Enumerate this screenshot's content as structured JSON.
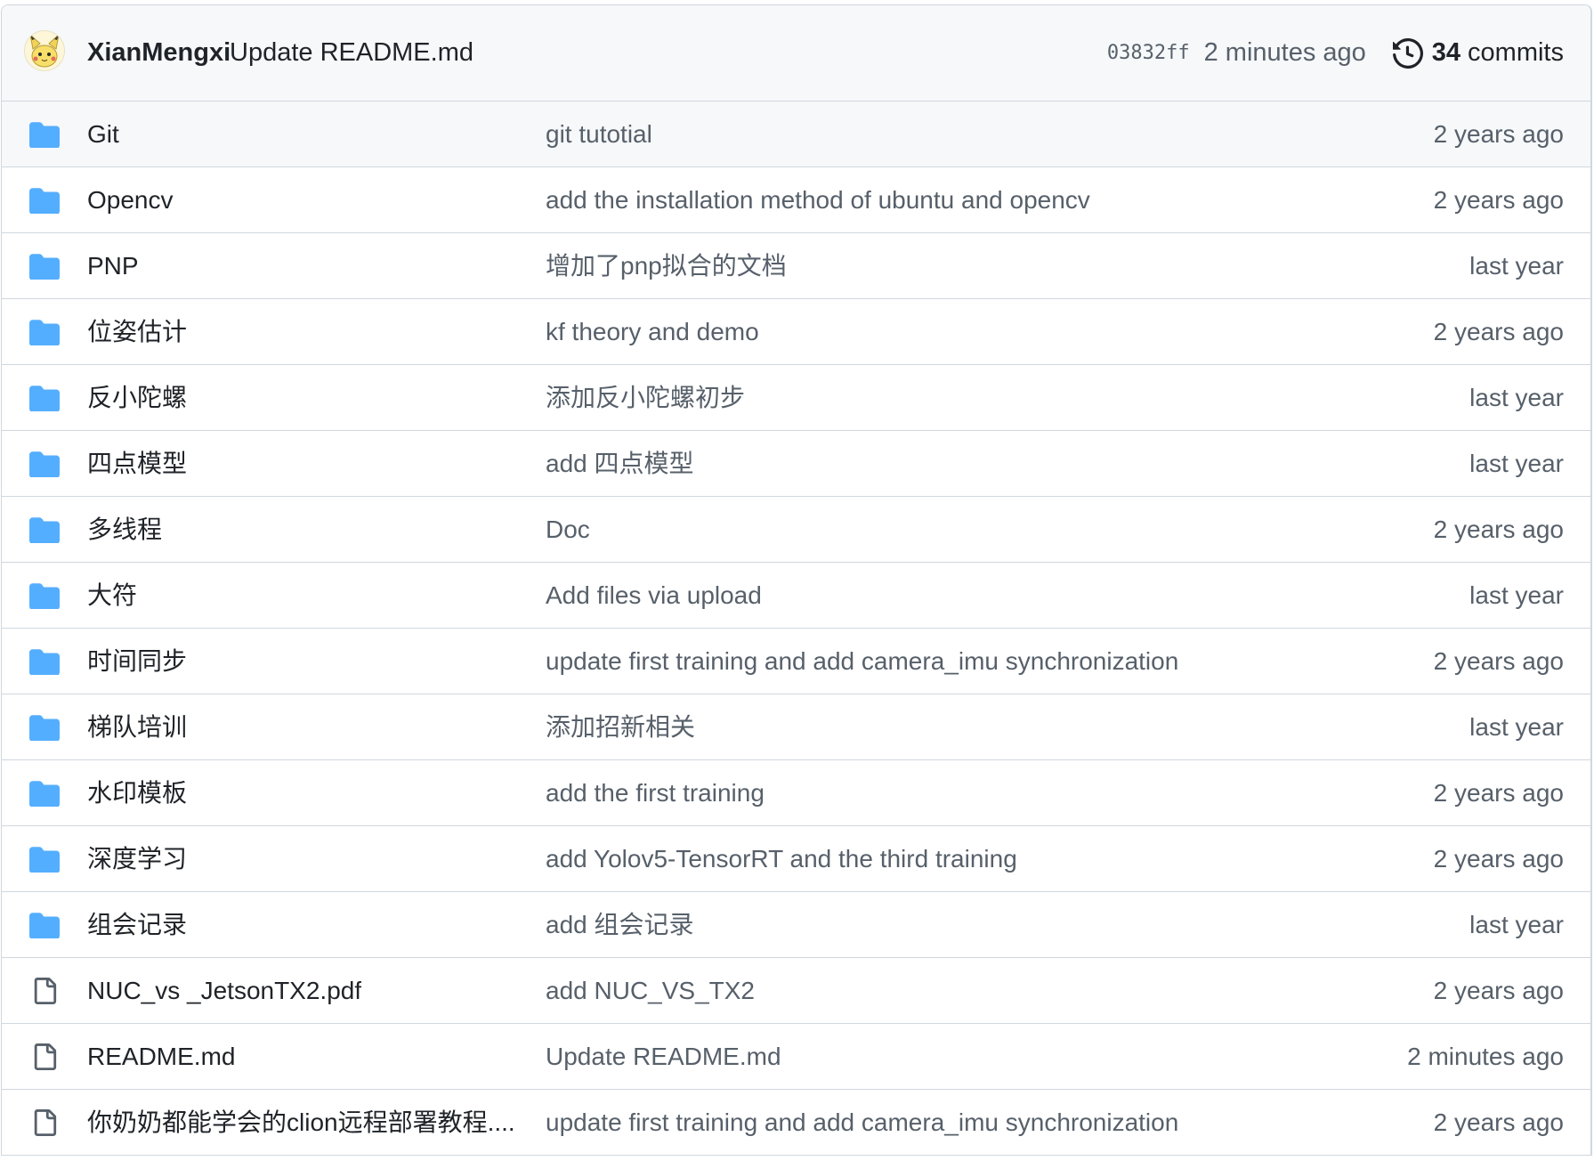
{
  "header": {
    "author": "XianMengxi",
    "message": "Update README.md",
    "sha": "03832ff",
    "age": "2 minutes ago",
    "commit_count": "34",
    "commit_label": "commits"
  },
  "colors": {
    "folder": "#54aeff",
    "file_icon": "#57606a",
    "muted_text": "#57606a",
    "border": "#d0d7de"
  },
  "files": [
    {
      "type": "folder",
      "icon": "folder-icon",
      "name": "Git",
      "message": "git tutotial",
      "age": "2 years ago"
    },
    {
      "type": "folder",
      "icon": "folder-icon",
      "name": "Opencv",
      "message": "add the installation method of ubuntu and opencv",
      "age": "2 years ago"
    },
    {
      "type": "folder",
      "icon": "folder-icon",
      "name": "PNP",
      "message": "增加了pnp拟合的文档",
      "age": "last year"
    },
    {
      "type": "folder",
      "icon": "folder-icon",
      "name": "位姿估计",
      "message": "kf theory and demo",
      "age": "2 years ago"
    },
    {
      "type": "folder",
      "icon": "folder-icon",
      "name": "反小陀螺",
      "message": "添加反小陀螺初步",
      "age": "last year"
    },
    {
      "type": "folder",
      "icon": "folder-icon",
      "name": "四点模型",
      "message": "add 四点模型",
      "age": "last year"
    },
    {
      "type": "folder",
      "icon": "folder-icon",
      "name": "多线程",
      "message": "Doc",
      "age": "2 years ago"
    },
    {
      "type": "folder",
      "icon": "folder-icon",
      "name": "大符",
      "message": "Add files via upload",
      "age": "last year"
    },
    {
      "type": "folder",
      "icon": "folder-icon",
      "name": "时间同步",
      "message": "update first training and add camera_imu synchronization",
      "age": "2 years ago"
    },
    {
      "type": "folder",
      "icon": "folder-icon",
      "name": "梯队培训",
      "message": "添加招新相关",
      "age": "last year"
    },
    {
      "type": "folder",
      "icon": "folder-icon",
      "name": "水印模板",
      "message": "add the first training",
      "age": "2 years ago"
    },
    {
      "type": "folder",
      "icon": "folder-icon",
      "name": "深度学习",
      "message": "add Yolov5-TensorRT and the third training",
      "age": "2 years ago"
    },
    {
      "type": "folder",
      "icon": "folder-icon",
      "name": "组会记录",
      "message": "add 组会记录",
      "age": "last year"
    },
    {
      "type": "file",
      "icon": "file-icon",
      "name": "NUC_vs _JetsonTX2.pdf",
      "message": "add NUC_VS_TX2",
      "age": "2 years ago"
    },
    {
      "type": "file",
      "icon": "file-icon",
      "name": "README.md",
      "message": "Update README.md",
      "age": "2 minutes ago"
    },
    {
      "type": "file",
      "icon": "file-icon",
      "name": "你奶奶都能学会的clion远程部署教程....",
      "message": "update first training and add camera_imu synchronization",
      "age": "2 years ago"
    }
  ]
}
